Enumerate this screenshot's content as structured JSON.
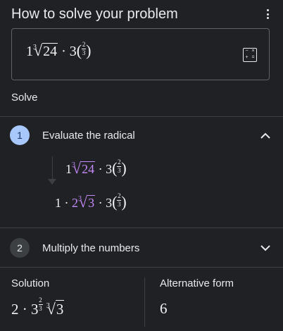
{
  "header": {
    "title": "How to solve your problem",
    "menu_icon": "more-vert-icon"
  },
  "problem": {
    "coef": "1",
    "root_index": "3",
    "radicand": "24",
    "dot": "·",
    "base": "3",
    "exp_num": "2",
    "exp_den": "3",
    "calculator_icon": "calculator-icon"
  },
  "solve_label": "Solve",
  "steps": [
    {
      "number": "1",
      "label": "Evaluate the radical",
      "expanded": true,
      "expr_before": {
        "coef": "1",
        "root_index": "3",
        "radicand": "24",
        "dot": "·",
        "base": "3",
        "exp_num": "2",
        "exp_den": "3"
      },
      "expr_after": {
        "coef": "1",
        "dot1": "·",
        "mult": "2",
        "root_index": "3",
        "radicand": "3",
        "dot2": "·",
        "base": "3",
        "exp_num": "2",
        "exp_den": "3"
      }
    },
    {
      "number": "2",
      "label": "Multiply the numbers",
      "expanded": false
    }
  ],
  "solution": {
    "label": "Solution",
    "coef": "2",
    "dot": "·",
    "base": "3",
    "exp_num": "2",
    "exp_den": "3",
    "root_index": "3",
    "radicand": "3"
  },
  "alternative": {
    "label": "Alternative form",
    "value": "6"
  },
  "colors": {
    "background": "#202124",
    "accent": "#a8c7fa",
    "highlight": "#c58af9",
    "divider": "#3c4043"
  }
}
